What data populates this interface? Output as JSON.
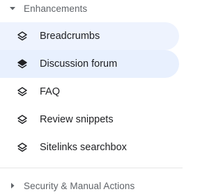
{
  "sections": {
    "enhancements": {
      "label": "Enhancements",
      "expanded": true,
      "icon": "caret-down-icon"
    },
    "security": {
      "label": "Security & Manual Actions",
      "expanded": false,
      "icon": "caret-right-icon"
    }
  },
  "items": [
    {
      "label": "Breadcrumbs",
      "icon": "layers-icon",
      "state": "hover"
    },
    {
      "label": "Discussion forum",
      "icon": "layers-icon",
      "state": "selected"
    },
    {
      "label": "FAQ",
      "icon": "layers-icon",
      "state": "default"
    },
    {
      "label": "Review snippets",
      "icon": "layers-icon",
      "state": "default"
    },
    {
      "label": "Sitelinks searchbox",
      "icon": "layers-icon",
      "state": "default"
    }
  ],
  "colors": {
    "hover_bg": "#eef3fe",
    "selected_bg": "#e8f0fe",
    "text": "#202124",
    "muted_text": "#5f6368"
  }
}
